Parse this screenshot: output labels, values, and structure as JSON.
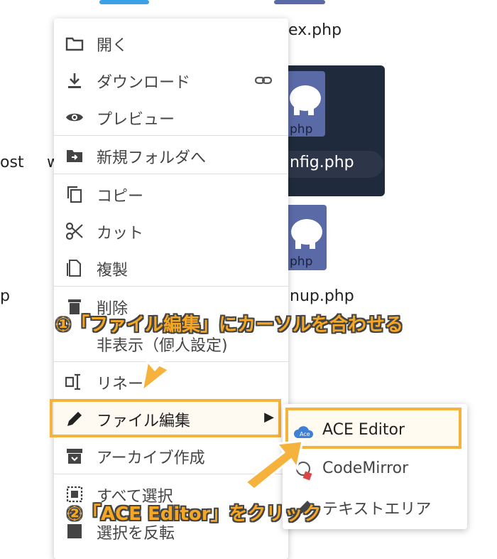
{
  "background_files": {
    "left_partial": [
      "ost",
      "w",
      "p"
    ],
    "names": [
      "ex.php",
      "nfig.php",
      "nup.php"
    ],
    "thumb_ext": "php"
  },
  "context_menu": {
    "items": [
      {
        "label": "開く",
        "icon": "folder-icon"
      },
      {
        "label": "ダウンロード",
        "icon": "download-icon",
        "shortcut_icon": "link-icon"
      },
      {
        "label": "プレビュー",
        "icon": "eye-icon"
      },
      {
        "label": "新規フォルダへ",
        "icon": "folder-move-icon"
      },
      {
        "label": "コピー",
        "icon": "copy-icon"
      },
      {
        "label": "カット",
        "icon": "scissors-icon"
      },
      {
        "label": "複製",
        "icon": "duplicate-icon"
      },
      {
        "label": "削除",
        "icon": "trash-icon"
      },
      {
        "label": "非表示（個人設定)",
        "icon": ""
      },
      {
        "label": "リネー",
        "icon": "rename-icon"
      },
      {
        "label": "ファイル編集",
        "icon": "pencil-icon",
        "submenu_arrow": "▶"
      },
      {
        "label": "アーカイブ作成",
        "icon": "archive-icon"
      },
      {
        "label": "すべて選択",
        "icon": "select-all-icon"
      },
      {
        "label": "選択を反転",
        "icon": "invert-select-icon"
      }
    ]
  },
  "submenu": {
    "items": [
      {
        "label": "ACE Editor",
        "icon": "ace-cloud-icon"
      },
      {
        "label": "CodeMirror",
        "icon": "codemirror-icon"
      },
      {
        "label": "テキストエリア",
        "icon": "textarea-icon"
      }
    ]
  },
  "annotations": {
    "step1": "①「ファイル編集」にカーソルを合わせる",
    "step2": "②「ACE Editor」をクリック",
    "accent_color": "#f5b23c"
  }
}
